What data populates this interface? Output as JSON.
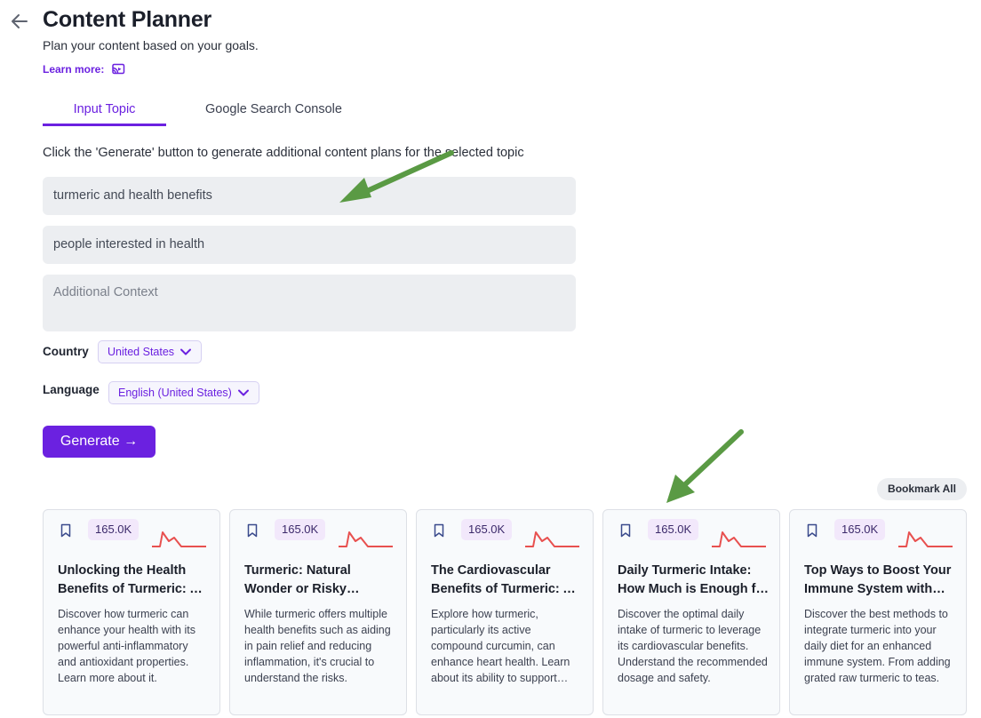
{
  "header": {
    "title": "Content Planner",
    "subtitle": "Plan your content based on your goals.",
    "learn_more": "Learn more:"
  },
  "tabs": [
    {
      "label": "Input Topic",
      "active": true
    },
    {
      "label": "Google Search Console",
      "active": false
    }
  ],
  "form": {
    "instruction": "Click the 'Generate' button to generate additional content plans for the selected topic",
    "topic_value": "turmeric and health benefits",
    "audience_value": "people interested in health",
    "context_placeholder": "Additional Context",
    "country_label": "Country",
    "country_value": "United States",
    "language_label": "Language",
    "language_value": "English (United States)",
    "generate_label": "Generate →"
  },
  "results": {
    "bookmark_all_label": "Bookmark All",
    "cards": [
      {
        "volume": "165.0K",
        "title": "Unlocking the Health Benefits of Turmeric: A Comprehensive Guide",
        "description": "Discover how turmeric can enhance your health with its powerful anti-inflammatory and antioxidant properties. Learn more about it."
      },
      {
        "volume": "165.0K",
        "title": "Turmeric: Natural Wonder or Risky Remedy?",
        "description": "While turmeric offers multiple health benefits such as aiding in pain relief and reducing inflammation, it's crucial to understand the risks."
      },
      {
        "volume": "165.0K",
        "title": "The Cardiovascular Benefits of Turmeric: A Closer Look",
        "description": "Explore how turmeric, particularly its active compound curcumin, can enhance heart health. Learn about its ability to support circulation."
      },
      {
        "volume": "165.0K",
        "title": "Daily Turmeric Intake: How Much is Enough for Heart Health?",
        "description": "Discover the optimal daily intake of turmeric to leverage its cardiovascular benefits. Understand the recommended dosage and safety."
      },
      {
        "volume": "165.0K",
        "title": "Top Ways to Boost Your Immune System with Turmeric",
        "description": "Discover the best methods to integrate turmeric into your daily diet for an enhanced immune system. From adding grated raw turmeric to teas."
      }
    ]
  },
  "colors": {
    "accent": "#6b21e0",
    "trend_line": "#e8504f",
    "annotation_arrow": "#5a9a44"
  }
}
